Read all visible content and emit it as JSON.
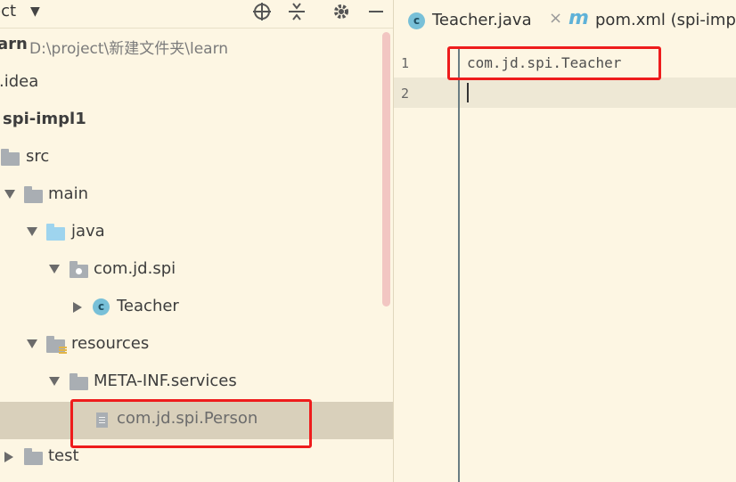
{
  "project_panel": {
    "title": "ect",
    "tree": [
      {
        "label": "arn",
        "path": "D:\\project\\新建文件夹\\learn"
      },
      {
        "label": ".idea"
      },
      {
        "label": "spi-impl1"
      },
      {
        "label": "src"
      },
      {
        "label": "main"
      },
      {
        "label": "java"
      },
      {
        "label": "com.jd.spi"
      },
      {
        "label": "Teacher"
      },
      {
        "label": "resources"
      },
      {
        "label": "META-INF.services"
      },
      {
        "label": "com.jd.spi.Person"
      },
      {
        "label": "test"
      }
    ]
  },
  "editor": {
    "tabs": [
      {
        "label": "Teacher.java",
        "icon": "class-icon",
        "close": "×"
      },
      {
        "label": "pom.xml (spi-impl",
        "icon": "maven-icon",
        "icon_text": "m"
      }
    ],
    "line_numbers": [
      "1",
      "2"
    ],
    "code_lines": [
      "com.jd.spi.Teacher",
      ""
    ]
  },
  "colors": {
    "background": "#fdf6e3",
    "highlight_box": "#ee1c1c",
    "selected_row": "#d9d0bb",
    "folder": "#a9aeb3",
    "source_folder": "#9ed4ee"
  }
}
